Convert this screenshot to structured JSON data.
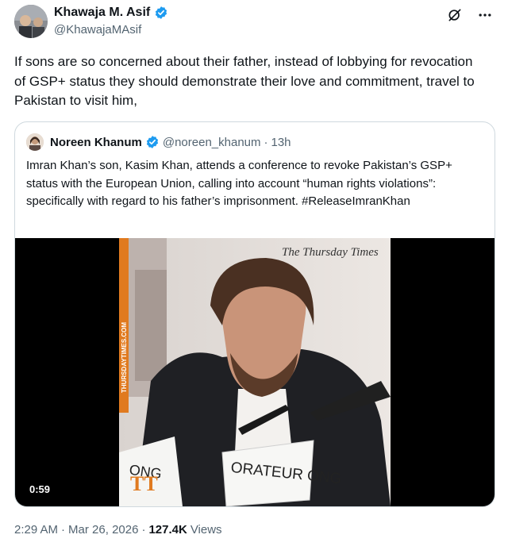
{
  "author": {
    "name": "Khawaja M. Asif",
    "handle": "@KhawajaMAsif"
  },
  "tweet": {
    "text": "If sons are so concerned about their father, instead of lobbying for revocation of GSP+ status they should demonstrate their love and commitment, travel to Pakistan to visit him,"
  },
  "quote": {
    "name": "Noreen Khanum",
    "handle": "@noreen_khanum",
    "separator": "·",
    "time": "13h",
    "text": "Imran Khan’s son, Kasim Khan, attends a conference to revoke Pakistan’s GSP+ status with the European Union, calling into account “human rights violations”: specifically with regard to his father’s imprisonment. #ReleaseImranKhan",
    "video": {
      "duration": "0:59",
      "watermark": "The Thursday Times",
      "side_banner": "THURSDAYTIMES.COM",
      "placard_left": "ONG",
      "placard_right": "ORATEUR ONG",
      "corner_logo": "TT"
    }
  },
  "meta": {
    "time": "2:29 AM",
    "separator1": "·",
    "date": "Mar 26, 2026",
    "separator2": "·",
    "views_count": "127.4K",
    "views_label": "Views"
  },
  "icons": {
    "verified": "verified-badge-icon",
    "grok": "grok-icon",
    "more": "more-icon"
  },
  "colors": {
    "verified": "#1d9bf0",
    "secondary_text": "#536471",
    "border": "#cfd9de",
    "banner_orange": "#e07a1f"
  }
}
